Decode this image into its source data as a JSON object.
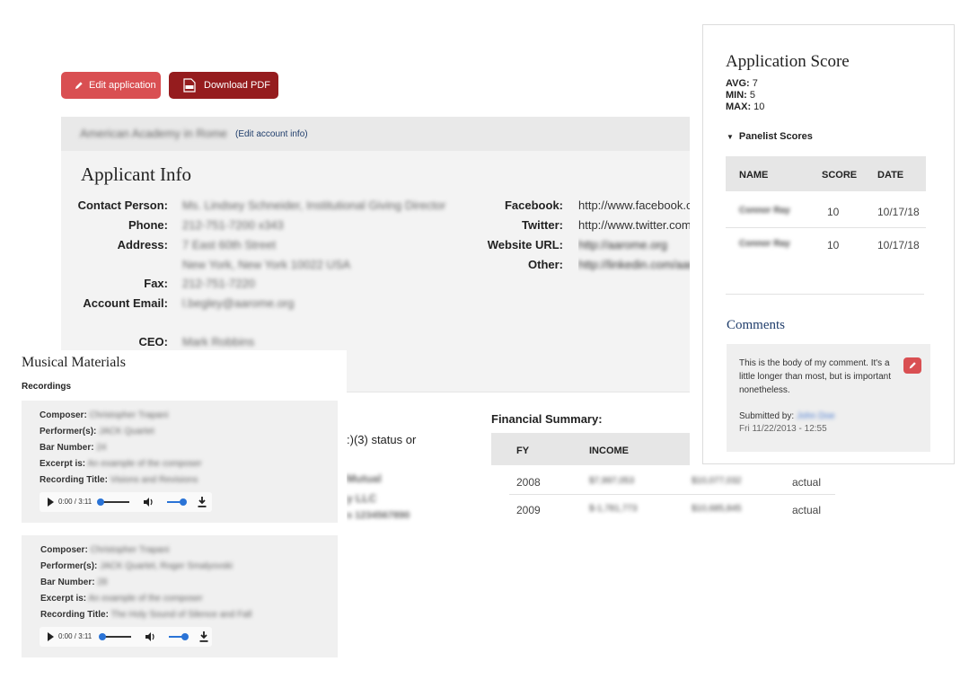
{
  "toolbar": {
    "edit_label": "Edit application",
    "pdf_label": "Download PDF"
  },
  "account": {
    "org_name": "American Academy in Rome",
    "edit_link": "(Edit account info)"
  },
  "applicant": {
    "title": "Applicant Info",
    "left_fields": [
      {
        "label": "Contact Person:",
        "value": "Ms. Lindsey Schneider, Institutional Giving Director"
      },
      {
        "label": "Phone:",
        "value": "212-751-7200 x343"
      },
      {
        "label": "Address:",
        "value": "7 East 60th Street"
      },
      {
        "label": "",
        "value": "New York, New York 10022 USA"
      },
      {
        "label": "Fax:",
        "value": "212-751-7220"
      },
      {
        "label": "Account Email:",
        "value": "l.begley@aarome.org"
      },
      {
        "label": "CEO:",
        "value": "Mark Robbins"
      }
    ],
    "right_fields": [
      {
        "label": "Facebook:",
        "value": "http://www.facebook.com/aarome"
      },
      {
        "label": "Twitter:",
        "value": "http://www.twitter.com/aarome"
      },
      {
        "label": "Website URL:",
        "value": "http://aarome.org"
      },
      {
        "label": "Other:",
        "value": "http://linkedin.com/aarome"
      }
    ],
    "partial_status": ":)(3) status or",
    "partial_lines": [
      "Mutual",
      "y LLC",
      "s 1234567890"
    ]
  },
  "financial": {
    "title": "Financial Summary:",
    "headers": [
      "FY",
      "INCOME"
    ],
    "rows": [
      {
        "fy": "2008",
        "income": "$7,997,053",
        "expense": "$10,077,032",
        "status": "actual"
      },
      {
        "fy": "2009",
        "income": "$-1,781,773",
        "expense": "$10,685,845",
        "status": "actual"
      }
    ]
  },
  "score": {
    "title": "Application Score",
    "avg_label": "AVG:",
    "avg": "7",
    "min_label": "MIN:",
    "min": "5",
    "max_label": "MAX:",
    "max": "10",
    "panelist_heading": "Panelist Scores",
    "headers": [
      "NAME",
      "SCORE",
      "DATE"
    ],
    "rows": [
      {
        "name": "Connor Ray",
        "score": "10",
        "date": "10/17/18"
      },
      {
        "name": "Connor Ray",
        "score": "10",
        "date": "10/17/18"
      }
    ]
  },
  "comments": {
    "title": "Comments",
    "body": "This is the body of my comment. It's a little longer than most, but is important nonetheless.",
    "submitted_label": "Submitted by:",
    "submitted_by": "John Doe",
    "date": "Fri 11/22/2013 - 12:55"
  },
  "musical": {
    "title": "Musical Materials",
    "subtitle": "Recordings",
    "labels": {
      "composer": "Composer:",
      "performers": "Performer(s):",
      "bar": "Bar Number:",
      "excerpt": "Excerpt is:",
      "title": "Recording Title:"
    },
    "recordings": [
      {
        "composer": "Christopher Trapani",
        "performers": "JACK Quartet",
        "bar": "24",
        "excerpt": "An example of the composer",
        "title": "Visions and Revisions",
        "time": "0:00 / 3:11"
      },
      {
        "composer": "Christopher Trapani",
        "performers": "JACK Quartet, Roger Smalyovski",
        "bar": "28",
        "excerpt": "An example of the composer",
        "title": "The Holy Sound of Silence and Fall",
        "time": "0:00 / 3:11"
      }
    ]
  },
  "colors": {
    "edit_button": "#d94f52",
    "pdf_button": "#951c1e",
    "link": "#1f3d6b",
    "audio_accent": "#2a73d6"
  }
}
